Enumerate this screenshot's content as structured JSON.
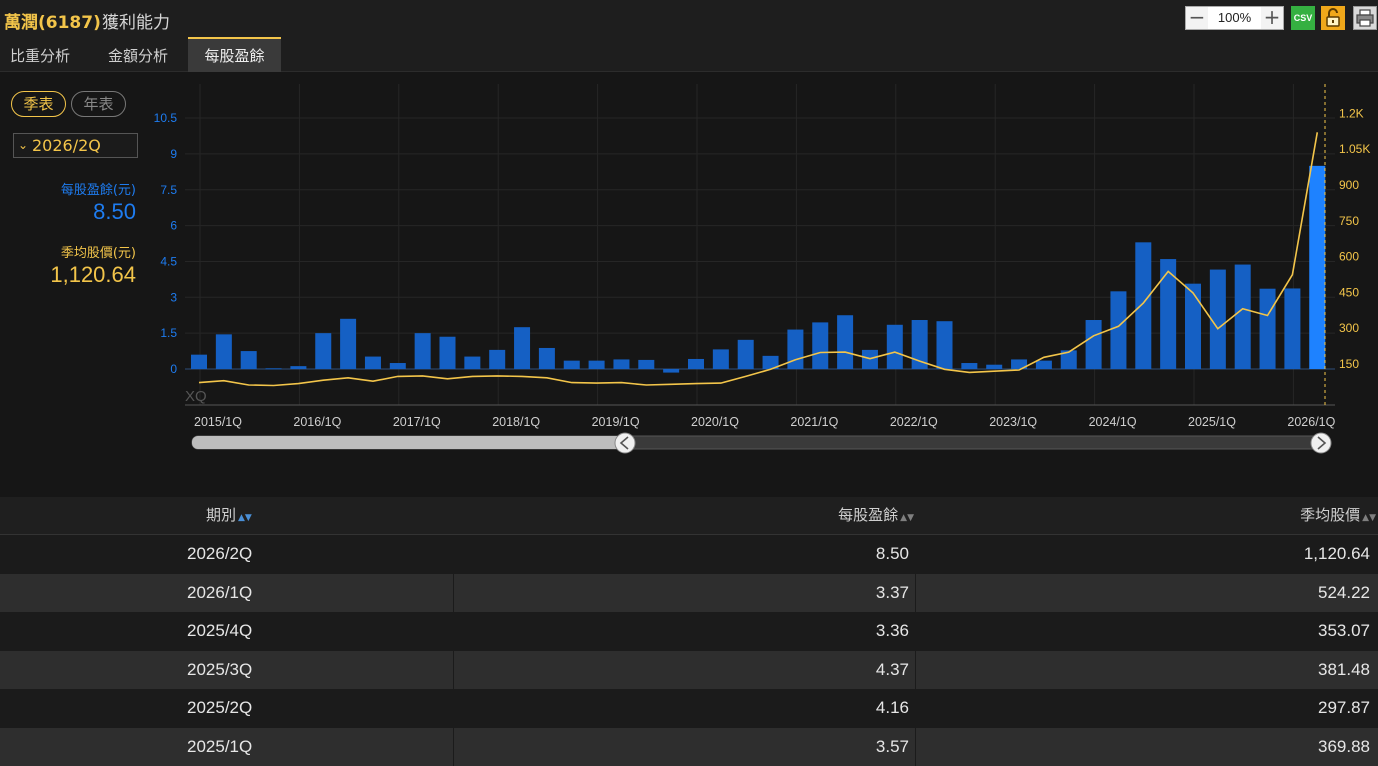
{
  "header": {
    "stock_name": "萬潤(6187)",
    "page_title": "獲利能力",
    "zoom": "100%",
    "csv_label": "CSV",
    "icons": [
      "minus-icon",
      "plus-icon",
      "csv-icon",
      "lock-icon",
      "print-icon"
    ]
  },
  "tabs": [
    {
      "label": "比重分析",
      "active": false
    },
    {
      "label": "金額分析",
      "active": false
    },
    {
      "label": "每股盈餘",
      "active": true
    }
  ],
  "controls": {
    "quarterly_label": "季表",
    "annual_label": "年表",
    "selected_period": "2026/2Q"
  },
  "info": {
    "eps_label": "每股盈餘(元)",
    "eps_value": "8.50",
    "price_label": "季均股價(元)",
    "price_value": "1,120.64"
  },
  "colors": {
    "accent": "#f3c54a",
    "eps_blue": "#1e7cf0",
    "bar": "#1560c4",
    "bar_highlight": "#1e82ff",
    "line": "#f3c54a"
  },
  "chart_data": {
    "type": "bar",
    "watermark": "XQ",
    "categories": [
      "2015/1Q",
      "2015/2Q",
      "2015/3Q",
      "2015/4Q",
      "2016/1Q",
      "2016/2Q",
      "2016/3Q",
      "2016/4Q",
      "2017/1Q",
      "2017/2Q",
      "2017/3Q",
      "2017/4Q",
      "2018/1Q",
      "2018/2Q",
      "2018/3Q",
      "2018/4Q",
      "2019/1Q",
      "2019/2Q",
      "2019/3Q",
      "2019/4Q",
      "2020/1Q",
      "2020/2Q",
      "2020/3Q",
      "2020/4Q",
      "2021/1Q",
      "2021/2Q",
      "2021/3Q",
      "2021/4Q",
      "2022/1Q",
      "2022/2Q",
      "2022/3Q",
      "2022/4Q",
      "2023/1Q",
      "2023/2Q",
      "2023/3Q",
      "2023/4Q",
      "2024/1Q",
      "2024/2Q",
      "2024/3Q",
      "2024/4Q",
      "2025/1Q",
      "2025/2Q",
      "2025/3Q",
      "2025/4Q",
      "2026/1Q",
      "2026/2Q"
    ],
    "xtick_labels": [
      "2015/1Q",
      "2016/1Q",
      "2017/1Q",
      "2018/1Q",
      "2019/1Q",
      "2020/1Q",
      "2021/1Q",
      "2022/1Q",
      "2023/1Q",
      "2024/1Q",
      "2025/1Q",
      "2026/1Q"
    ],
    "series": [
      {
        "name": "每股盈餘",
        "axis": "left",
        "kind": "bar",
        "values": [
          0.6,
          1.45,
          0.75,
          0.03,
          0.12,
          1.5,
          2.1,
          0.52,
          0.25,
          1.5,
          1.35,
          0.52,
          0.8,
          1.75,
          0.88,
          0.35,
          0.35,
          0.4,
          0.38,
          -0.15,
          0.42,
          0.82,
          1.22,
          0.55,
          1.65,
          1.95,
          2.25,
          0.8,
          1.85,
          2.05,
          2.0,
          0.25,
          0.18,
          0.4,
          0.35,
          0.78,
          2.05,
          3.25,
          5.3,
          4.6,
          3.57,
          4.16,
          4.37,
          3.36,
          3.37,
          8.5
        ]
      },
      {
        "name": "季均股價",
        "axis": "right",
        "kind": "line",
        "values": [
          72,
          80,
          62,
          60,
          68,
          82,
          92,
          78,
          98,
          100,
          88,
          98,
          100,
          98,
          92,
          72,
          70,
          72,
          62,
          65,
          68,
          70,
          98,
          128,
          168,
          198,
          200,
          172,
          200,
          162,
          128,
          115,
          120,
          125,
          178,
          200,
          268,
          308,
          405,
          538,
          448,
          297.87,
          381.48,
          353.07,
          524.22,
          1120.64
        ]
      }
    ],
    "y_left": {
      "ticks": [
        0,
        1.5,
        3,
        4.5,
        6,
        7.5,
        9,
        10.5
      ],
      "tick_labels": [
        "0",
        "1.5",
        "3",
        "4.5",
        "6",
        "7.5",
        "9",
        "10.5"
      ],
      "range": [
        -1.05,
        10.5
      ]
    },
    "y_right": {
      "ticks": [
        150,
        300,
        450,
        600,
        750,
        900,
        1050,
        1200
      ],
      "tick_labels": [
        "150",
        "300",
        "450",
        "600",
        "750",
        "900",
        "1.05K",
        "1.2K"
      ],
      "range": [
        0,
        1200
      ]
    },
    "grid": true,
    "legend": "none",
    "highlighted_index": 45
  },
  "table": {
    "headers": [
      "期別",
      "每股盈餘",
      "季均股價"
    ],
    "rows": [
      [
        "2026/2Q",
        "8.50",
        "1,120.64"
      ],
      [
        "2026/1Q",
        "3.37",
        "524.22"
      ],
      [
        "2025/4Q",
        "3.36",
        "353.07"
      ],
      [
        "2025/3Q",
        "4.37",
        "381.48"
      ],
      [
        "2025/2Q",
        "4.16",
        "297.87"
      ],
      [
        "2025/1Q",
        "3.57",
        "369.88"
      ]
    ]
  }
}
